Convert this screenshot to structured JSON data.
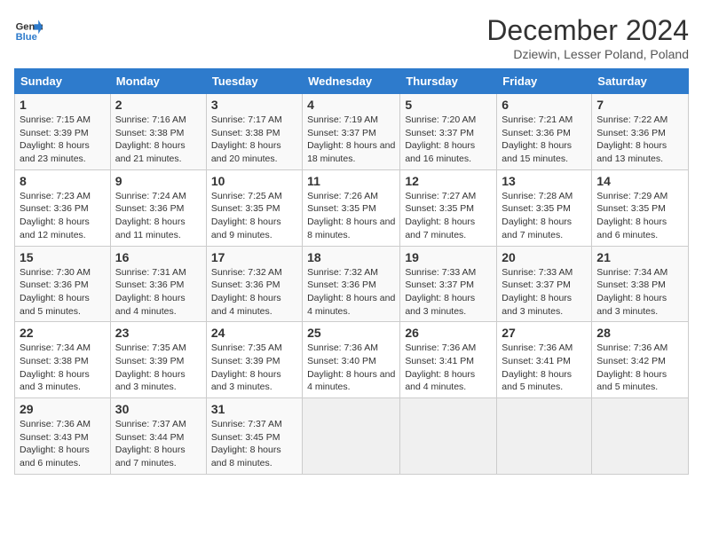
{
  "header": {
    "logo": "GeneralBlue",
    "title": "December 2024",
    "subtitle": "Dziewin, Lesser Poland, Poland"
  },
  "days_of_week": [
    "Sunday",
    "Monday",
    "Tuesday",
    "Wednesday",
    "Thursday",
    "Friday",
    "Saturday"
  ],
  "weeks": [
    [
      {
        "num": "1",
        "sunrise": "7:15 AM",
        "sunset": "3:39 PM",
        "daylight": "8 hours and 23 minutes."
      },
      {
        "num": "2",
        "sunrise": "7:16 AM",
        "sunset": "3:38 PM",
        "daylight": "8 hours and 21 minutes."
      },
      {
        "num": "3",
        "sunrise": "7:17 AM",
        "sunset": "3:38 PM",
        "daylight": "8 hours and 20 minutes."
      },
      {
        "num": "4",
        "sunrise": "7:19 AM",
        "sunset": "3:37 PM",
        "daylight": "8 hours and 18 minutes."
      },
      {
        "num": "5",
        "sunrise": "7:20 AM",
        "sunset": "3:37 PM",
        "daylight": "8 hours and 16 minutes."
      },
      {
        "num": "6",
        "sunrise": "7:21 AM",
        "sunset": "3:36 PM",
        "daylight": "8 hours and 15 minutes."
      },
      {
        "num": "7",
        "sunrise": "7:22 AM",
        "sunset": "3:36 PM",
        "daylight": "8 hours and 13 minutes."
      }
    ],
    [
      {
        "num": "8",
        "sunrise": "7:23 AM",
        "sunset": "3:36 PM",
        "daylight": "8 hours and 12 minutes."
      },
      {
        "num": "9",
        "sunrise": "7:24 AM",
        "sunset": "3:36 PM",
        "daylight": "8 hours and 11 minutes."
      },
      {
        "num": "10",
        "sunrise": "7:25 AM",
        "sunset": "3:35 PM",
        "daylight": "8 hours and 9 minutes."
      },
      {
        "num": "11",
        "sunrise": "7:26 AM",
        "sunset": "3:35 PM",
        "daylight": "8 hours and 8 minutes."
      },
      {
        "num": "12",
        "sunrise": "7:27 AM",
        "sunset": "3:35 PM",
        "daylight": "8 hours and 7 minutes."
      },
      {
        "num": "13",
        "sunrise": "7:28 AM",
        "sunset": "3:35 PM",
        "daylight": "8 hours and 7 minutes."
      },
      {
        "num": "14",
        "sunrise": "7:29 AM",
        "sunset": "3:35 PM",
        "daylight": "8 hours and 6 minutes."
      }
    ],
    [
      {
        "num": "15",
        "sunrise": "7:30 AM",
        "sunset": "3:36 PM",
        "daylight": "8 hours and 5 minutes."
      },
      {
        "num": "16",
        "sunrise": "7:31 AM",
        "sunset": "3:36 PM",
        "daylight": "8 hours and 4 minutes."
      },
      {
        "num": "17",
        "sunrise": "7:32 AM",
        "sunset": "3:36 PM",
        "daylight": "8 hours and 4 minutes."
      },
      {
        "num": "18",
        "sunrise": "7:32 AM",
        "sunset": "3:36 PM",
        "daylight": "8 hours and 4 minutes."
      },
      {
        "num": "19",
        "sunrise": "7:33 AM",
        "sunset": "3:37 PM",
        "daylight": "8 hours and 3 minutes."
      },
      {
        "num": "20",
        "sunrise": "7:33 AM",
        "sunset": "3:37 PM",
        "daylight": "8 hours and 3 minutes."
      },
      {
        "num": "21",
        "sunrise": "7:34 AM",
        "sunset": "3:38 PM",
        "daylight": "8 hours and 3 minutes."
      }
    ],
    [
      {
        "num": "22",
        "sunrise": "7:34 AM",
        "sunset": "3:38 PM",
        "daylight": "8 hours and 3 minutes."
      },
      {
        "num": "23",
        "sunrise": "7:35 AM",
        "sunset": "3:39 PM",
        "daylight": "8 hours and 3 minutes."
      },
      {
        "num": "24",
        "sunrise": "7:35 AM",
        "sunset": "3:39 PM",
        "daylight": "8 hours and 3 minutes."
      },
      {
        "num": "25",
        "sunrise": "7:36 AM",
        "sunset": "3:40 PM",
        "daylight": "8 hours and 4 minutes."
      },
      {
        "num": "26",
        "sunrise": "7:36 AM",
        "sunset": "3:41 PM",
        "daylight": "8 hours and 4 minutes."
      },
      {
        "num": "27",
        "sunrise": "7:36 AM",
        "sunset": "3:41 PM",
        "daylight": "8 hours and 5 minutes."
      },
      {
        "num": "28",
        "sunrise": "7:36 AM",
        "sunset": "3:42 PM",
        "daylight": "8 hours and 5 minutes."
      }
    ],
    [
      {
        "num": "29",
        "sunrise": "7:36 AM",
        "sunset": "3:43 PM",
        "daylight": "8 hours and 6 minutes."
      },
      {
        "num": "30",
        "sunrise": "7:37 AM",
        "sunset": "3:44 PM",
        "daylight": "8 hours and 7 minutes."
      },
      {
        "num": "31",
        "sunrise": "7:37 AM",
        "sunset": "3:45 PM",
        "daylight": "8 hours and 8 minutes."
      },
      null,
      null,
      null,
      null
    ]
  ]
}
